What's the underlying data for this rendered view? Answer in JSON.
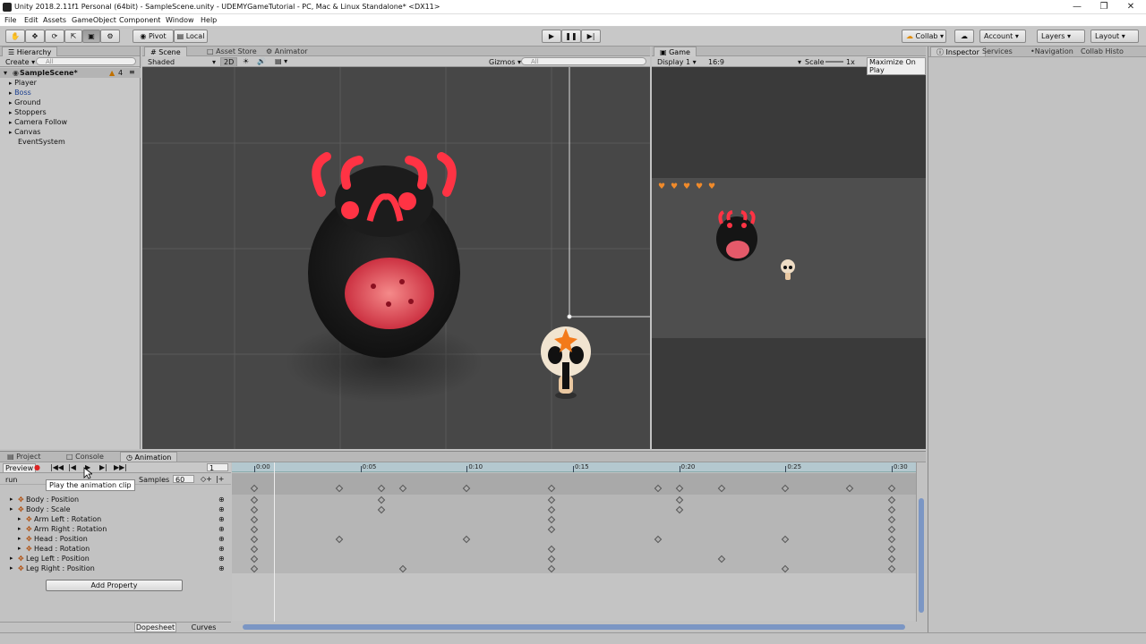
{
  "window": {
    "title": "Unity 2018.2.11f1 Personal (64bit) - SampleScene.unity - UDEMYGameTutorial - PC, Mac & Linux Standalone* <DX11>",
    "minimize_icon": "minimize-icon",
    "maximize_icon": "restore-icon",
    "close_icon": "close-icon"
  },
  "menu": [
    "File",
    "Edit",
    "Assets",
    "GameObject",
    "Component",
    "Window",
    "Help"
  ],
  "toolbar": {
    "pivot": "Pivot",
    "local": "Local",
    "collab": "Collab",
    "account": "Account",
    "layers": "Layers",
    "layout": "Layout"
  },
  "hierarchy": {
    "tab": "Hierarchy",
    "create": "Create",
    "search_placeholder": "All",
    "scene": "SampleScene*",
    "scene_count": "4",
    "items": [
      "Player",
      "Boss",
      "Ground",
      "Stoppers",
      "Camera Follow",
      "Canvas",
      "EventSystem"
    ]
  },
  "scene_view": {
    "tabs": [
      "Scene",
      "Asset Store",
      "Animator"
    ],
    "shading": "Shaded",
    "mode_2d": "2D",
    "gizmos": "Gizmos",
    "search_placeholder": "All"
  },
  "game_view": {
    "tab": "Game",
    "display": "Display 1",
    "aspect": "16:9",
    "scale_label": "Scale",
    "scale_value": "1x",
    "maximize": "Maximize On Play",
    "hearts": 5
  },
  "inspector": {
    "tabs": [
      "Inspector",
      "Services",
      "Navigation",
      "Collab Histo"
    ]
  },
  "animation": {
    "tabs": [
      "Project",
      "Console",
      "Animation"
    ],
    "preview": "Preview",
    "frame": "1",
    "clip": "run",
    "samples_label": "Samples",
    "samples_value": "60",
    "tooltip": "Play the animation clip",
    "properties": [
      "Body : Position",
      "Body : Scale",
      "Arm Left : Rotation",
      "Arm Right : Rotation",
      "Head : Position",
      "Head : Rotation",
      "Leg Left : Position",
      "Leg Right : Position"
    ],
    "add_property": "Add Property",
    "dopesheet": "Dopesheet",
    "curves": "Curves",
    "time_labels": [
      "0:00",
      "0:05",
      "0:10",
      "0:15",
      "0:20",
      "0:25",
      "0:30"
    ],
    "keyframes": {
      "summary": [
        0,
        8,
        12,
        14,
        20,
        28,
        38,
        40,
        44,
        50,
        56,
        60
      ],
      "rows": [
        [
          0,
          12,
          28,
          40,
          60
        ],
        [
          0,
          12,
          28,
          40,
          60
        ],
        [
          0,
          28,
          60
        ],
        [
          0,
          28,
          60
        ],
        [
          0,
          8,
          20,
          38,
          50,
          60
        ],
        [
          0,
          28,
          60
        ],
        [
          0,
          28,
          44,
          60
        ],
        [
          0,
          14,
          28,
          50,
          60
        ]
      ]
    }
  }
}
